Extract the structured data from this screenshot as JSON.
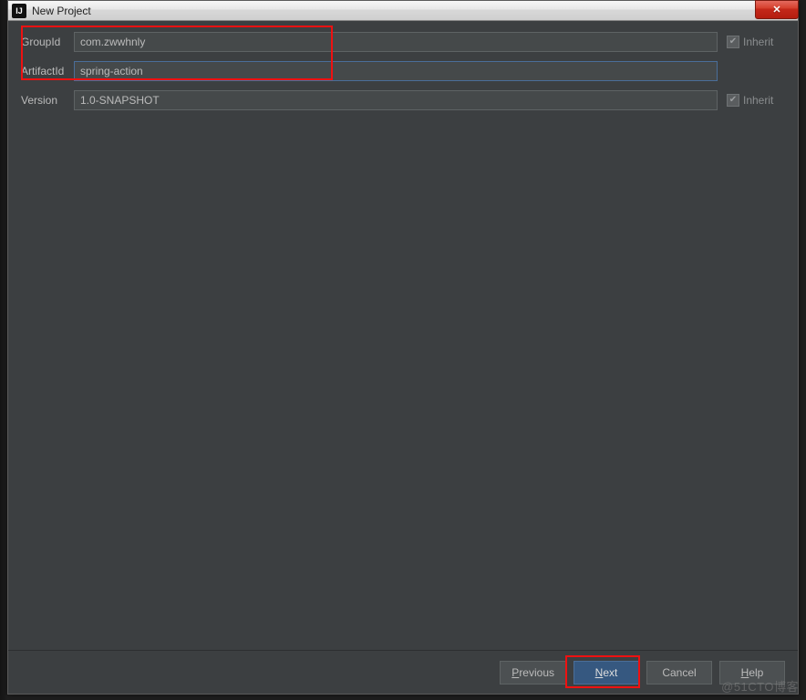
{
  "window": {
    "title": "New Project",
    "appicon_text": "IJ",
    "close_glyph": "✕"
  },
  "fields": {
    "group": {
      "label": "GroupId",
      "value": "com.zwwhnly"
    },
    "artifact": {
      "label": "ArtifactId",
      "value": "spring-action"
    },
    "version": {
      "label": "Version",
      "value": "1.0-SNAPSHOT"
    }
  },
  "inherit": {
    "label": "Inherit"
  },
  "buttons": {
    "previous": {
      "mn": "P",
      "rest": "revious"
    },
    "next": {
      "mn": "N",
      "rest": "ext"
    },
    "cancel": {
      "text": "Cancel"
    },
    "help": {
      "mn": "H",
      "rest": "elp"
    }
  },
  "watermark": "@51CTO博客"
}
